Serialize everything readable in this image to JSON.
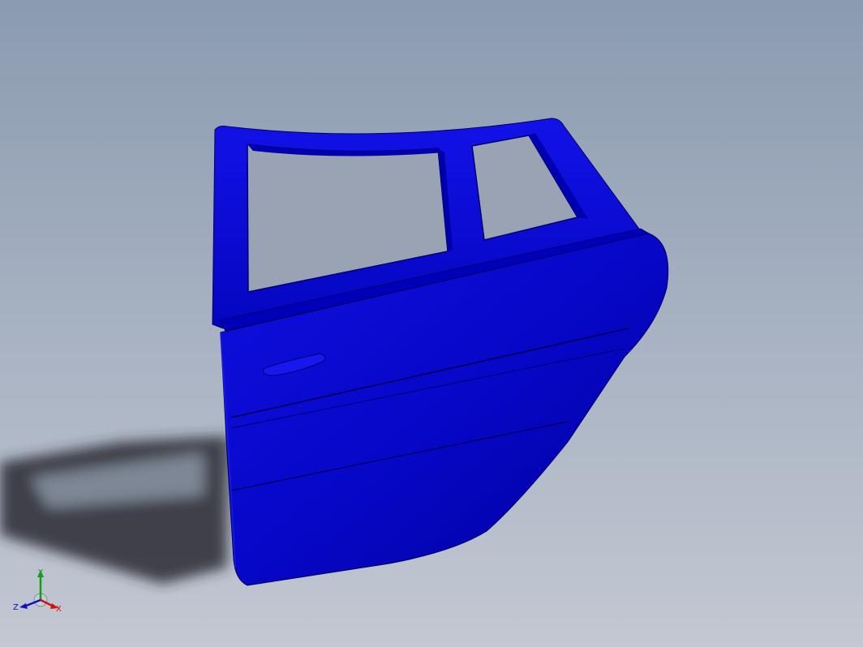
{
  "viewport": {
    "background_top": "#8b9bb0",
    "background_bottom": "#c3c8d2"
  },
  "model": {
    "name": "car-rear-door",
    "color": "#0a0ad0",
    "shade_color": "#0000a0"
  },
  "triad": {
    "x_label": "X",
    "y_label": "Y",
    "z_label": "Z",
    "x_color": "#d01010",
    "y_color": "#10a010",
    "z_color": "#1010c0"
  }
}
